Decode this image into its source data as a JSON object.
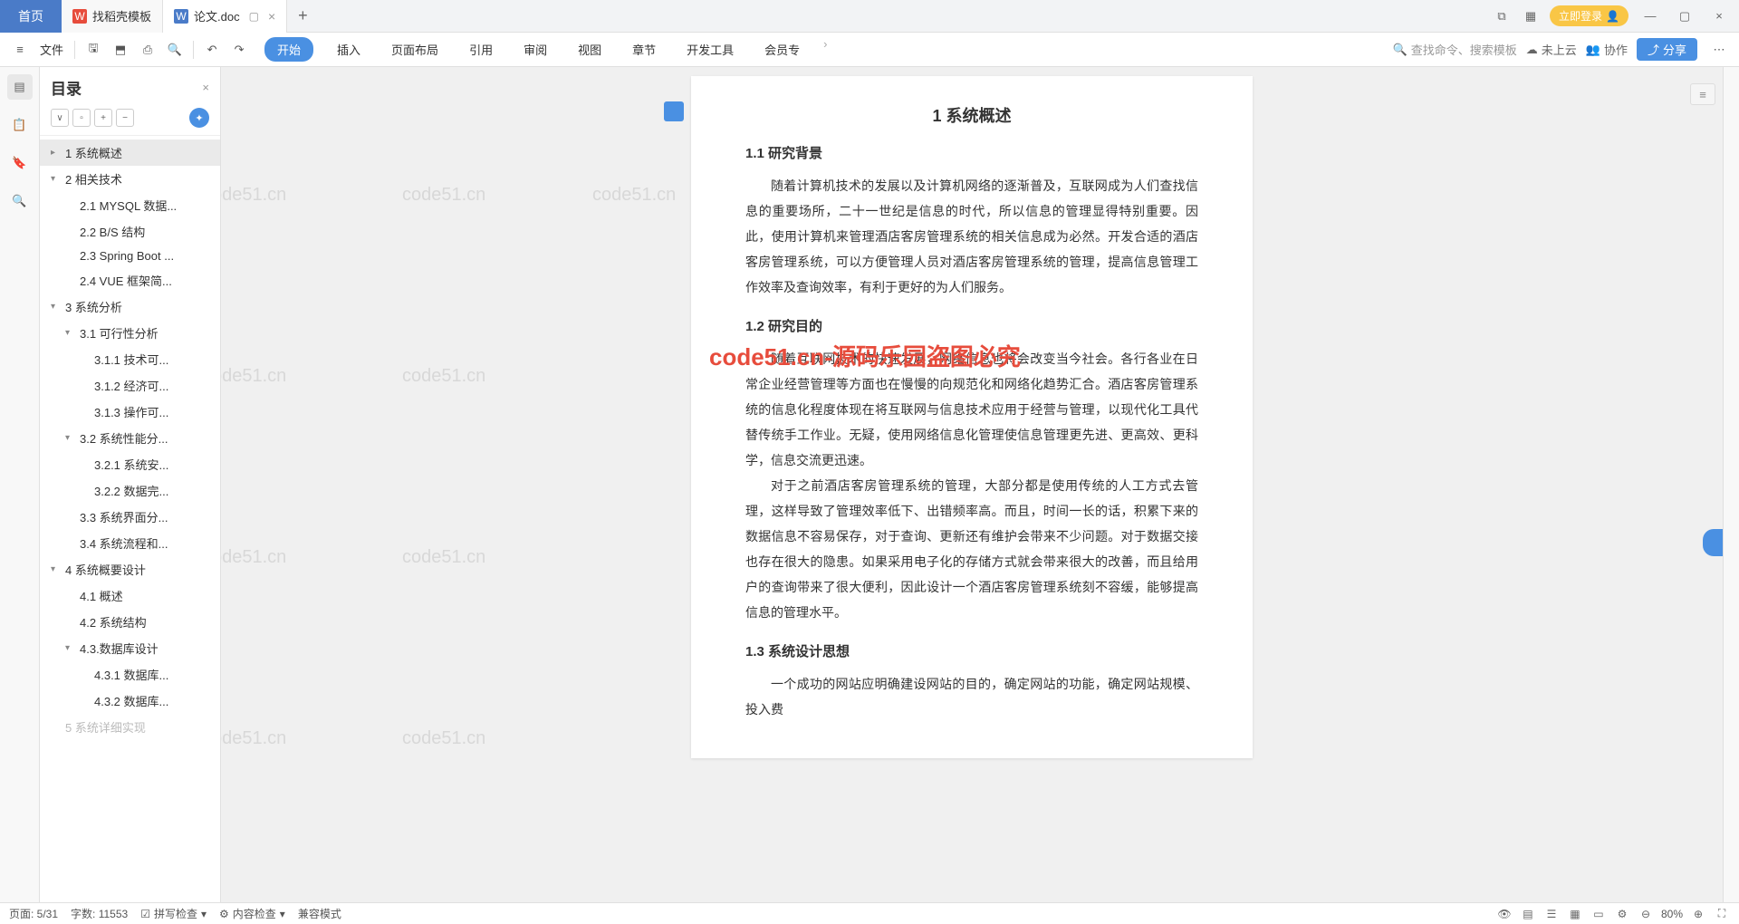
{
  "title_bar": {
    "home": "首页",
    "tabs": [
      {
        "icon": "W",
        "label": "找稻壳模板",
        "active": false
      },
      {
        "icon": "W",
        "label": "论文.doc",
        "active": true
      }
    ],
    "login": "立即登录"
  },
  "ribbon": {
    "file": "文件",
    "tabs": [
      "开始",
      "插入",
      "页面布局",
      "引用",
      "审阅",
      "视图",
      "章节",
      "开发工具",
      "会员专"
    ],
    "active": 0,
    "search": "查找命令、搜索模板",
    "cloud": "未上云",
    "collab": "协作",
    "share": "分享"
  },
  "toc": {
    "title": "目录",
    "items": [
      {
        "level": 1,
        "label": "1 系统概述",
        "chev": ">",
        "active": true
      },
      {
        "level": 1,
        "label": "2 相关技术",
        "chev": "v"
      },
      {
        "level": 2,
        "label": "2.1 MYSQL 数据..."
      },
      {
        "level": 2,
        "label": "2.2 B/S 结构"
      },
      {
        "level": 2,
        "label": "2.3 Spring Boot ..."
      },
      {
        "level": 2,
        "label": "2.4 VUE 框架简..."
      },
      {
        "level": 1,
        "label": "3 系统分析",
        "chev": "v"
      },
      {
        "level": 2,
        "label": "3.1 可行性分析",
        "chev": "v"
      },
      {
        "level": 3,
        "label": "3.1.1 技术可..."
      },
      {
        "level": 3,
        "label": "3.1.2 经济可..."
      },
      {
        "level": 3,
        "label": "3.1.3 操作可..."
      },
      {
        "level": 2,
        "label": "3.2 系统性能分...",
        "chev": "v"
      },
      {
        "level": 3,
        "label": "3.2.1 系统安..."
      },
      {
        "level": 3,
        "label": "3.2.2 数据完..."
      },
      {
        "level": 2,
        "label": "3.3 系统界面分..."
      },
      {
        "level": 2,
        "label": "3.4 系统流程和..."
      },
      {
        "level": 1,
        "label": "4 系统概要设计",
        "chev": "v"
      },
      {
        "level": 2,
        "label": "4.1 概述"
      },
      {
        "level": 2,
        "label": "4.2 系统结构"
      },
      {
        "level": 2,
        "label": "4.3.数据库设计",
        "chev": "v"
      },
      {
        "level": 3,
        "label": "4.3.1 数据库..."
      },
      {
        "level": 3,
        "label": "4.3.2 数据库..."
      },
      {
        "level": 1,
        "label": "5 系统详细实现",
        "faded": true
      }
    ]
  },
  "doc": {
    "h1": "1 系统概述",
    "h2_1": "1.1 研究背景",
    "p1": "随着计算机技术的发展以及计算机网络的逐渐普及，互联网成为人们查找信息的重要场所，二十一世纪是信息的时代，所以信息的管理显得特别重要。因此，使用计算机来管理酒店客房管理系统的相关信息成为必然。开发合适的酒店客房管理系统，可以方便管理人员对酒店客房管理系统的管理，提高信息管理工作效率及查询效率，有利于更好的为人们服务。",
    "h2_2": "1.2 研究目的",
    "p2": "随着互联网技术的快速发展，网络信息也将会改变当今社会。各行各业在日常企业经营管理等方面也在慢慢的向规范化和网络化趋势汇合。酒店客房管理系统的信息化程度体现在将互联网与信息技术应用于经营与管理，以现代化工具代替传统手工作业。无疑，使用网络信息化管理使信息管理更先进、更高效、更科学，信息交流更迅速。",
    "p3": "对于之前酒店客房管理系统的管理，大部分都是使用传统的人工方式去管理，这样导致了管理效率低下、出错频率高。而且，时间一长的话，积累下来的数据信息不容易保存，对于查询、更新还有维护会带来不少问题。对于数据交接也存在很大的隐患。如果采用电子化的存储方式就会带来很大的改善，而且给用户的查询带来了很大便利，因此设计一个酒店客房管理系统刻不容缓，能够提高信息的管理水平。",
    "h2_3": "1.3 系统设计思想",
    "p4": "一个成功的网站应明确建设网站的目的，确定网站的功能，确定网站规模、投入费",
    "watermark_red": "code51.cn-源码乐园盗图必究",
    "watermark_grey": "code51.cn"
  },
  "status": {
    "page": "页面: 5/31",
    "words": "字数: 11553",
    "spell": "拼写检查",
    "content": "内容检查",
    "compat": "兼容模式",
    "zoom": "80%"
  }
}
